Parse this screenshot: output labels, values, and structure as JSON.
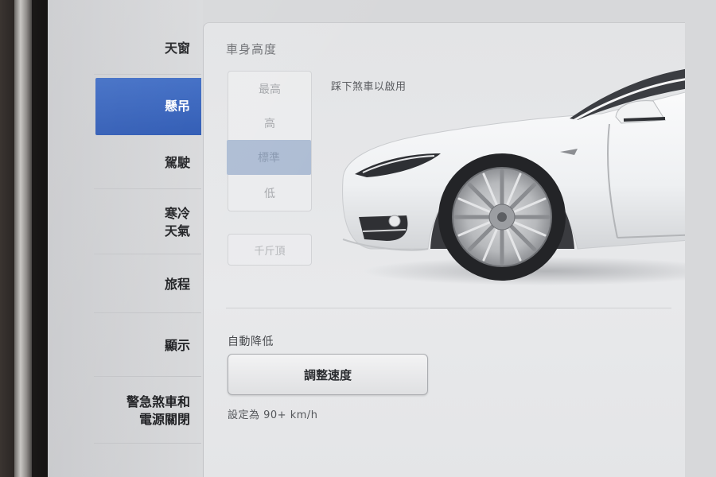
{
  "sidebar": {
    "items": [
      {
        "label": "天窗",
        "active": false
      },
      {
        "label": "懸吊",
        "active": true
      },
      {
        "label": "駕駛",
        "active": false
      },
      {
        "label": "寒冷\n天氣",
        "active": false
      },
      {
        "label": "旅程",
        "active": false
      },
      {
        "label": "顯示",
        "active": false
      },
      {
        "label": "警急煞車和\n電源關閉",
        "active": false
      }
    ]
  },
  "suspension": {
    "title": "車身高度",
    "hint": "踩下煞車以啟用",
    "height_options": [
      "最高",
      "高",
      "標準",
      "低"
    ],
    "selected_option": "標準",
    "jack_label": "千斤頂",
    "auto_lower_label": "自動降低",
    "adjust_speed_label": "調整速度",
    "speed_setting": "設定為 90+ km/h"
  },
  "colors": {
    "accent": "#2c58b3",
    "selected_segment": "#aebdd4"
  }
}
